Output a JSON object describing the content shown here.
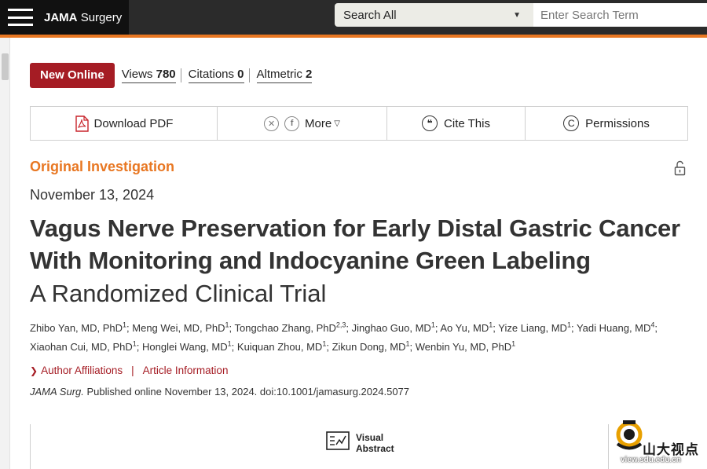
{
  "header": {
    "brand_prefix": "JAMA",
    "brand_suffix": "Surgery",
    "search_scope": "Search All",
    "search_placeholder": "Enter Search Term"
  },
  "metrics": {
    "badge": "New Online",
    "views_label": "Views",
    "views_value": "780",
    "citations_label": "Citations",
    "citations_value": "0",
    "altmetric_label": "Altmetric",
    "altmetric_value": "2"
  },
  "toolbar": {
    "download_pdf": "Download PDF",
    "more": "More",
    "cite_this": "Cite This",
    "permissions": "Permissions"
  },
  "article": {
    "type": "Original Investigation",
    "date": "November 13, 2024",
    "title": "Vagus Nerve Preservation for Early Distal Gastric Cancer With Monitoring and Indocyanine Green Labeling",
    "subtitle": "A Randomized Clinical Trial",
    "authors": [
      {
        "name": "Zhibo Yan, MD, PhD",
        "aff": "1"
      },
      {
        "name": "Meng Wei, MD, PhD",
        "aff": "1"
      },
      {
        "name": "Tongchao Zhang, PhD",
        "aff": "2,3"
      },
      {
        "name": "Jinghao Guo, MD",
        "aff": "1"
      },
      {
        "name": "Ao Yu, MD",
        "aff": "1"
      },
      {
        "name": "Yize Liang, MD",
        "aff": "1"
      },
      {
        "name": "Yadi Huang, MD",
        "aff": "4"
      },
      {
        "name": "Xiaohan Cui, MD, PhD",
        "aff": "1"
      },
      {
        "name": "Honglei Wang, MD",
        "aff": "1"
      },
      {
        "name": "Kuiquan Zhou, MD",
        "aff": "1"
      },
      {
        "name": "Zikun Dong, MD",
        "aff": "1"
      },
      {
        "name": "Wenbin Yu, MD, PhD",
        "aff": "1"
      }
    ],
    "author_affiliations": "Author Affiliations",
    "article_information": "Article Information",
    "journal_abbrev": "JAMA Surg.",
    "citation_rest": " Published online November 13, 2024. doi:10.1001/jamasurg.2024.5077",
    "visual_abstract_line1": "Visual",
    "visual_abstract_line2": "Abstract"
  },
  "watermark": {
    "text": "山大视点",
    "url": "view.sdu.edu.cn"
  },
  "colors": {
    "accent_orange": "#e87722",
    "badge_red": "#a51c24",
    "topbar_dark": "#2b2b2b"
  },
  "icons": [
    "hamburger-icon",
    "dropdown-caret-icon",
    "pdf-icon",
    "x-social-icon",
    "facebook-icon",
    "quote-icon",
    "copyright-icon",
    "unlock-icon",
    "chevron-right-icon",
    "visual-abstract-icon",
    "sdu-logo-icon"
  ]
}
